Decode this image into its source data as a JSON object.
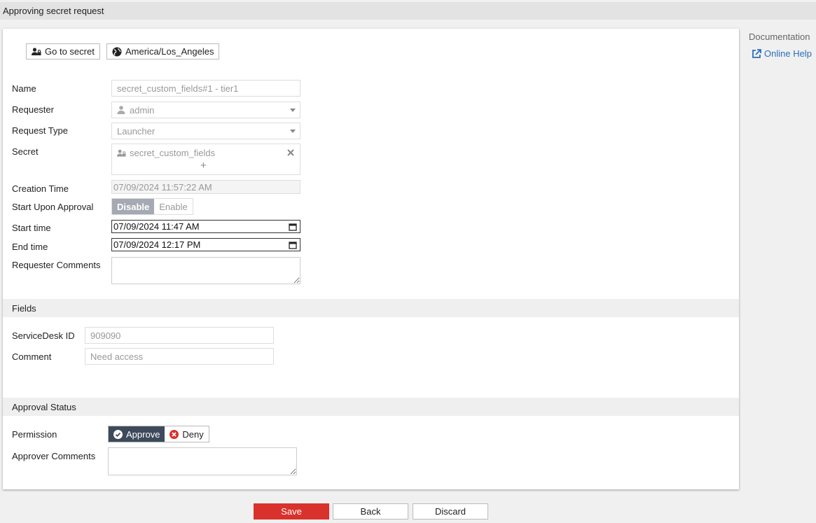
{
  "window": {
    "title": "Approving secret request"
  },
  "sidebar": {
    "documentation": "Documentation",
    "online_help": "Online Help"
  },
  "toolbar": {
    "go_to_secret": "Go to secret",
    "timezone": "America/Los_Angeles"
  },
  "form": {
    "name": {
      "label": "Name",
      "value": "secret_custom_fields#1 - tier1"
    },
    "requester": {
      "label": "Requester",
      "value": "admin"
    },
    "request_type": {
      "label": "Request Type",
      "value": "Launcher"
    },
    "secret": {
      "label": "Secret",
      "value": "secret_custom_fields",
      "add": "+"
    },
    "creation_time": {
      "label": "Creation Time",
      "value": "07/09/2024 11:57:22 AM"
    },
    "start_upon_approval": {
      "label": "Start Upon Approval",
      "options": [
        "Disable",
        "Enable"
      ],
      "selected": "Disable"
    },
    "start_time": {
      "label": "Start time",
      "value": "07/09/2024 11:47 AM"
    },
    "end_time": {
      "label": "End time",
      "value": "07/09/2024 12:17 PM"
    },
    "requester_comments": {
      "label": "Requester Comments",
      "value": ""
    }
  },
  "fields_section": {
    "title": "Fields",
    "servicedesk_id": {
      "label": "ServiceDesk ID",
      "value": "909090"
    },
    "comment": {
      "label": "Comment",
      "value": "Need access"
    }
  },
  "approval_section": {
    "title": "Approval Status",
    "permission": {
      "label": "Permission",
      "approve": "Approve",
      "deny": "Deny",
      "selected": "Approve"
    },
    "approver_comments": {
      "label": "Approver Comments",
      "value": ""
    }
  },
  "actions": {
    "save": "Save",
    "back": "Back",
    "discard": "Discard"
  },
  "colors": {
    "save": "#d9312b",
    "approve_selected": "#3d4a5c",
    "toggle_selected": "#a4a9b3",
    "link": "#2a6ebb",
    "deny_icon": "#d9312b"
  }
}
